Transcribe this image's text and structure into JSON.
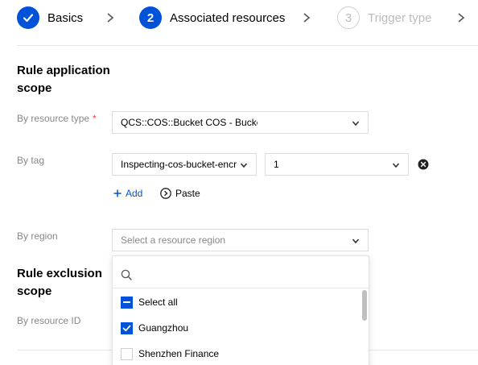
{
  "stepper": {
    "steps": [
      {
        "number": "",
        "label": "Basics",
        "state": "done"
      },
      {
        "number": "2",
        "label": "Associated resources",
        "state": "active"
      },
      {
        "number": "3",
        "label": "Trigger type",
        "state": "todo"
      }
    ]
  },
  "application_scope": {
    "title_line1": "Rule application",
    "title_line2": "scope",
    "resource_type": {
      "label": "By resource type",
      "required_mark": "*",
      "value": "QCS::COS::Bucket COS - Bucket"
    },
    "tag": {
      "label": "By tag",
      "key_value": "Inspecting-cos-bucket-encr",
      "value_value": "1",
      "add_label": "Add",
      "paste_label": "Paste"
    },
    "region": {
      "label": "By region",
      "placeholder": "Select a resource region"
    }
  },
  "exclusion_scope": {
    "title_line1": "Rule exclusion",
    "title_line2": "scope",
    "resource_id_label": "By resource ID"
  },
  "region_dropdown": {
    "search_value": "",
    "options": [
      {
        "label": "Select all",
        "state": "indeterminate"
      },
      {
        "label": "Guangzhou",
        "state": "checked"
      },
      {
        "label": "Shenzhen Finance",
        "state": "unchecked"
      }
    ]
  },
  "colors": {
    "accent": "#0052d9",
    "required": "#e54545",
    "muted_text": "#888888",
    "disabled": "#bbbbbb"
  }
}
